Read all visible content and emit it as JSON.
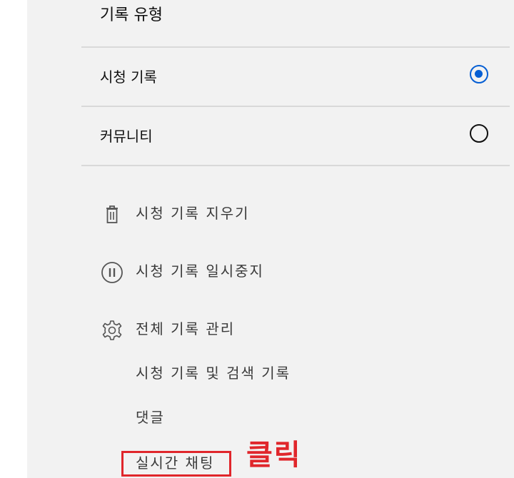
{
  "history_type": {
    "title": "기록 유형",
    "options": [
      {
        "label": "시청 기록",
        "selected": true
      },
      {
        "label": "커뮤니티",
        "selected": false
      }
    ]
  },
  "actions": [
    {
      "label": "시청 기록 지우기",
      "icon": "trash-icon"
    },
    {
      "label": "시청 기록 일시중지",
      "icon": "pause-circle-icon"
    },
    {
      "label": "전체 기록 관리",
      "icon": "gear-icon"
    }
  ],
  "manage_sub_items": [
    {
      "label": "시청 기록 및 검색 기록"
    },
    {
      "label": "댓글"
    },
    {
      "label": "실시간 채팅"
    }
  ],
  "annotation": {
    "text": "클릭",
    "color": "#e0262b"
  },
  "colors": {
    "accent": "#065fd4",
    "panel_bg": "#f2f2f2"
  }
}
